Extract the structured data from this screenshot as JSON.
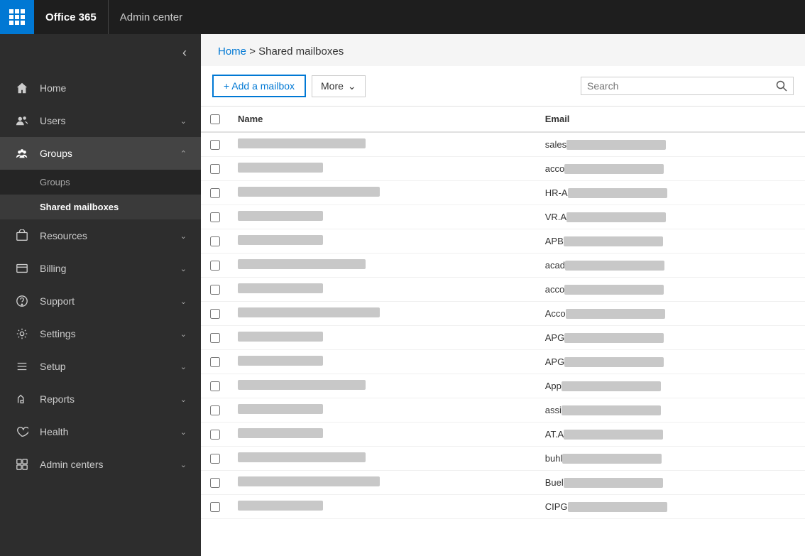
{
  "topbar": {
    "office365_label": "Office 365",
    "admincenter_label": "Admin center"
  },
  "sidebar": {
    "collapse_title": "Collapse",
    "items": [
      {
        "id": "home",
        "label": "Home",
        "icon": "home",
        "expandable": false,
        "active": false
      },
      {
        "id": "users",
        "label": "Users",
        "icon": "users",
        "expandable": true,
        "active": false
      },
      {
        "id": "groups",
        "label": "Groups",
        "icon": "groups",
        "expandable": true,
        "active": true,
        "subitems": [
          {
            "id": "groups-sub",
            "label": "Groups",
            "active": false
          },
          {
            "id": "shared-mailboxes",
            "label": "Shared mailboxes",
            "active": true
          }
        ]
      },
      {
        "id": "resources",
        "label": "Resources",
        "icon": "resources",
        "expandable": true,
        "active": false
      },
      {
        "id": "billing",
        "label": "Billing",
        "icon": "billing",
        "expandable": true,
        "active": false
      },
      {
        "id": "support",
        "label": "Support",
        "icon": "support",
        "expandable": true,
        "active": false
      },
      {
        "id": "settings",
        "label": "Settings",
        "icon": "settings",
        "expandable": true,
        "active": false
      },
      {
        "id": "setup",
        "label": "Setup",
        "icon": "setup",
        "expandable": true,
        "active": false
      },
      {
        "id": "reports",
        "label": "Reports",
        "icon": "reports",
        "expandable": true,
        "active": false
      },
      {
        "id": "health",
        "label": "Health",
        "icon": "health",
        "expandable": true,
        "active": false
      },
      {
        "id": "admin-centers",
        "label": "Admin centers",
        "icon": "admin-centers",
        "expandable": true,
        "active": false
      }
    ]
  },
  "breadcrumb": {
    "home_label": "Home",
    "separator": ">",
    "current_label": "Shared mailboxes"
  },
  "toolbar": {
    "add_label": "+ Add a mailbox",
    "more_label": "More",
    "search_placeholder": "Search"
  },
  "table": {
    "columns": [
      "",
      "Name",
      "Email"
    ],
    "rows": [
      {
        "email_prefix": "sales"
      },
      {
        "email_prefix": "acco"
      },
      {
        "email_prefix": "HR-A"
      },
      {
        "email_prefix": "VR.A"
      },
      {
        "email_prefix": "APB"
      },
      {
        "email_prefix": "acad"
      },
      {
        "email_prefix": "acco"
      },
      {
        "email_prefix": "Acco"
      },
      {
        "email_prefix": "APG"
      },
      {
        "email_prefix": "APG"
      },
      {
        "email_prefix": "App"
      },
      {
        "email_prefix": "assi"
      },
      {
        "email_prefix": "AT.A"
      },
      {
        "email_prefix": "buhl"
      },
      {
        "email_prefix": "Buel"
      },
      {
        "email_prefix": "CIPG"
      }
    ]
  }
}
